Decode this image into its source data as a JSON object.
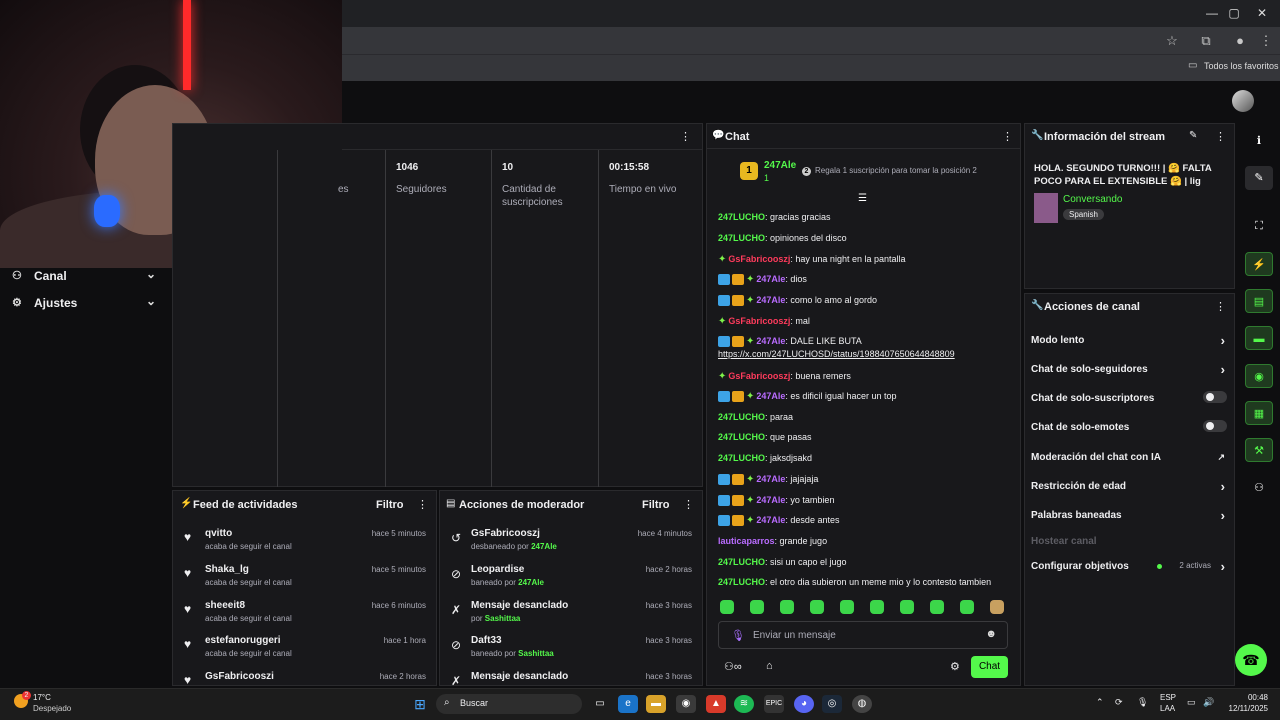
{
  "browser": {
    "bookmarks_folder": "Todos los favoritos",
    "win_minimize": "—",
    "win_maximize": "▢",
    "win_close": "✕",
    "icons": [
      "star-icon",
      "extensions-icon",
      "profile-icon",
      "menu-icon"
    ]
  },
  "sidebar": {
    "items": [
      {
        "label": "Canal",
        "icon": "canal-icon"
      },
      {
        "label": "Ajustes",
        "icon": "gear-icon"
      }
    ]
  },
  "stats": {
    "partial_label": "es",
    "items": [
      {
        "value": "1046",
        "label": "Seguidores"
      },
      {
        "value": "10",
        "label": "Cantidad de suscripciones"
      },
      {
        "value": "00:15:58",
        "label": "Tiempo en vivo"
      }
    ]
  },
  "chat": {
    "title": "Chat",
    "top_user": "247Ale",
    "top_rank": "1",
    "top_count": "1",
    "gift_text": "Regala 1 suscripción para tomar la posición 2",
    "gift_num": "2",
    "messages": [
      {
        "user": "247LUCHO",
        "color": "green",
        "text": ": gracias gracias",
        "badges": []
      },
      {
        "user": "247LUCHO",
        "color": "green",
        "text": ": opiniones del disco",
        "badges": []
      },
      {
        "user": "GsFabricooszj",
        "color": "red",
        "text": ": hay una night en la pantalla",
        "badges": [
          "diam"
        ]
      },
      {
        "user": "247Ale",
        "color": "purple",
        "text": ": dios",
        "badges": [
          "blue",
          "gold",
          "diam"
        ]
      },
      {
        "user": "247Ale",
        "color": "purple",
        "text": ": como lo amo al gordo",
        "badges": [
          "blue",
          "gold",
          "diam"
        ]
      },
      {
        "user": "GsFabricooszj",
        "color": "red",
        "text": ": mal",
        "badges": [
          "diam"
        ]
      },
      {
        "user": "247Ale",
        "color": "purple",
        "text": ": DALE LIKE BUTA",
        "badges": [
          "blue",
          "gold",
          "diam"
        ],
        "link": "https://x.com/247LUCHOSD/status/1988407650644848809"
      },
      {
        "user": "GsFabricooszj",
        "color": "red",
        "text": ": buena remers",
        "badges": [
          "diam"
        ]
      },
      {
        "user": "247Ale",
        "color": "purple",
        "text": ": es dificil igual hacer un top",
        "badges": [
          "blue",
          "gold",
          "diam"
        ]
      },
      {
        "user": "247LUCHO",
        "color": "green",
        "text": ": paraa",
        "badges": []
      },
      {
        "user": "247LUCHO",
        "color": "green",
        "text": ": que pasas",
        "badges": []
      },
      {
        "user": "247LUCHO",
        "color": "green",
        "text": ": jaksdjsakd",
        "badges": []
      },
      {
        "user": "247Ale",
        "color": "purple",
        "text": ": jajajaja",
        "badges": [
          "blue",
          "gold",
          "diam"
        ]
      },
      {
        "user": "247Ale",
        "color": "purple",
        "text": ": yo tambien",
        "badges": [
          "blue",
          "gold",
          "diam"
        ]
      },
      {
        "user": "247Ale",
        "color": "purple",
        "text": ": desde antes",
        "badges": [
          "blue",
          "gold",
          "diam"
        ]
      },
      {
        "user": "lauticaparros",
        "color": "purple",
        "text": ": grande jugo",
        "badges": []
      },
      {
        "user": "247LUCHO",
        "color": "green",
        "text": ": sisi un capo el jugo",
        "badges": []
      },
      {
        "user": "247LUCHO",
        "color": "green",
        "text": ": el otro dia subieron un meme mio y lo contesto tambien",
        "badges": []
      }
    ],
    "input_placeholder": "Enviar un mensaje",
    "send_label": "Chat"
  },
  "info": {
    "title": "Información del stream",
    "stream_title": "HOLA. SEGUNDO TURNO!!! | 🤗 FALTA POCO PARA EL EXTENSIBLE 🤗 | lig",
    "category": "Conversando",
    "tag": "Spanish"
  },
  "actions": {
    "title": "Acciones de canal",
    "rows": [
      {
        "label": "Modo lento",
        "type": "chevron"
      },
      {
        "label": "Chat de solo-seguidores",
        "type": "chevron"
      },
      {
        "label": "Chat de solo-suscriptores",
        "type": "toggle"
      },
      {
        "label": "Chat de solo-emotes",
        "type": "toggle"
      },
      {
        "label": "Moderación del chat con IA",
        "type": "external"
      },
      {
        "label": "Restricción de edad",
        "type": "chevron"
      },
      {
        "label": "Palabras baneadas",
        "type": "chevron"
      },
      {
        "label": "Hostear canal",
        "type": "disabled"
      },
      {
        "label": "Configurar objetivos",
        "type": "goals",
        "extra": "2 activas"
      }
    ]
  },
  "feed": {
    "title": "Feed de actividades",
    "filter": "Filtro",
    "items": [
      {
        "name": "qvitto",
        "sub": "acaba de seguir el canal",
        "time": "hace 5 minutos"
      },
      {
        "name": "Shaka_lg",
        "sub": "acaba de seguir el canal",
        "time": "hace 5 minutos"
      },
      {
        "name": "sheeeit8",
        "sub": "acaba de seguir el canal",
        "time": "hace 6 minutos"
      },
      {
        "name": "estefanoruggeri",
        "sub": "acaba de seguir el canal",
        "time": "hace 1 hora"
      },
      {
        "name": "GsFabricooszi",
        "sub": "",
        "time": "hace 2 horas"
      }
    ]
  },
  "mod": {
    "title": "Acciones de moderador",
    "filter": "Filtro",
    "items": [
      {
        "name": "GsFabricooszj",
        "pre": "desbaneado por ",
        "by": "247Ale",
        "time": "hace 4 minutos",
        "icon": "undo-icon"
      },
      {
        "name": "Leopardise",
        "pre": "baneado por ",
        "by": "247Ale",
        "time": "hace 2 horas",
        "icon": "ban-icon"
      },
      {
        "name": "Mensaje desanclado",
        "pre": "por ",
        "by": "Sashittaa",
        "time": "hace 3 horas",
        "icon": "unpin-icon"
      },
      {
        "name": "Daft33",
        "pre": "baneado por ",
        "by": "Sashittaa",
        "time": "hace 3 horas",
        "icon": "ban-icon"
      },
      {
        "name": "Mensaje desanclado",
        "pre": "",
        "by": "",
        "time": "hace 3 horas",
        "icon": "unpin-icon"
      }
    ]
  },
  "taskbar": {
    "weather_temp": "17°C",
    "weather_desc": "Despejado",
    "weather_badge": "2",
    "search": "Buscar",
    "lang1": "ESP",
    "lang2": "LAA",
    "time": "00:48",
    "date": "12/11/2025"
  },
  "colors": {
    "accent": "#54f84b",
    "purple": "#b96cff",
    "red": "#ff3b5c",
    "bg": "#0e0e10",
    "panel": "#18181b"
  }
}
